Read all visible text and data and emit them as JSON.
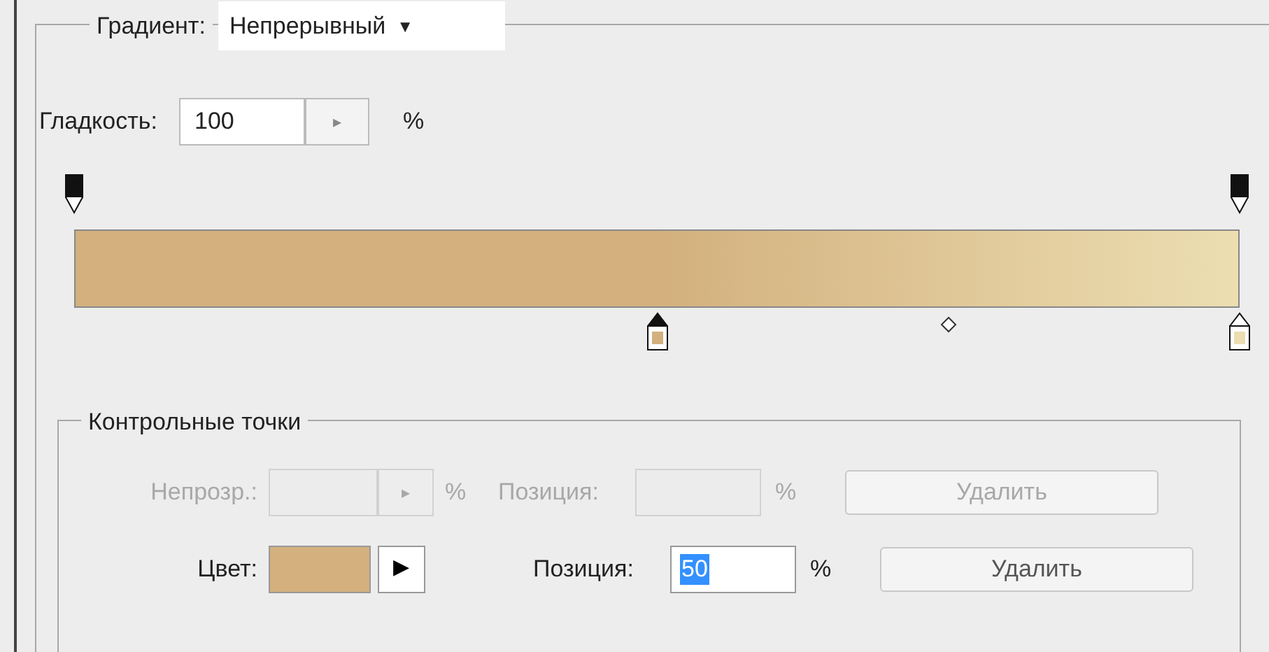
{
  "gradient": {
    "label": "Градиент:",
    "value": "Непрерывный",
    "caret": "▼"
  },
  "smoothness": {
    "label": "Гладкость:",
    "value": "100",
    "stepper": "▸",
    "unit": "%"
  },
  "opacity_stops": [
    {
      "selected": false
    },
    {
      "selected": false
    }
  ],
  "color_stops": [
    {
      "color": "#d3b07e",
      "selected": true
    },
    {
      "color": "#ecdeb1",
      "selected": false
    }
  ],
  "control_points": {
    "title": "Контрольные точки",
    "rows": [
      {
        "kind": "opacity",
        "disabled": true,
        "label": "Непрозр.:",
        "stepper": "▸",
        "unit": "%",
        "position_label": "Позиция:",
        "position_unit": "%",
        "button": "Удалить"
      },
      {
        "kind": "color",
        "disabled": false,
        "label": "Цвет:",
        "color": "#d3b07e",
        "arrow": "▶",
        "position_label": "Позиция:",
        "position_value": "50",
        "position_unit": "%",
        "button": "Удалить"
      }
    ]
  }
}
